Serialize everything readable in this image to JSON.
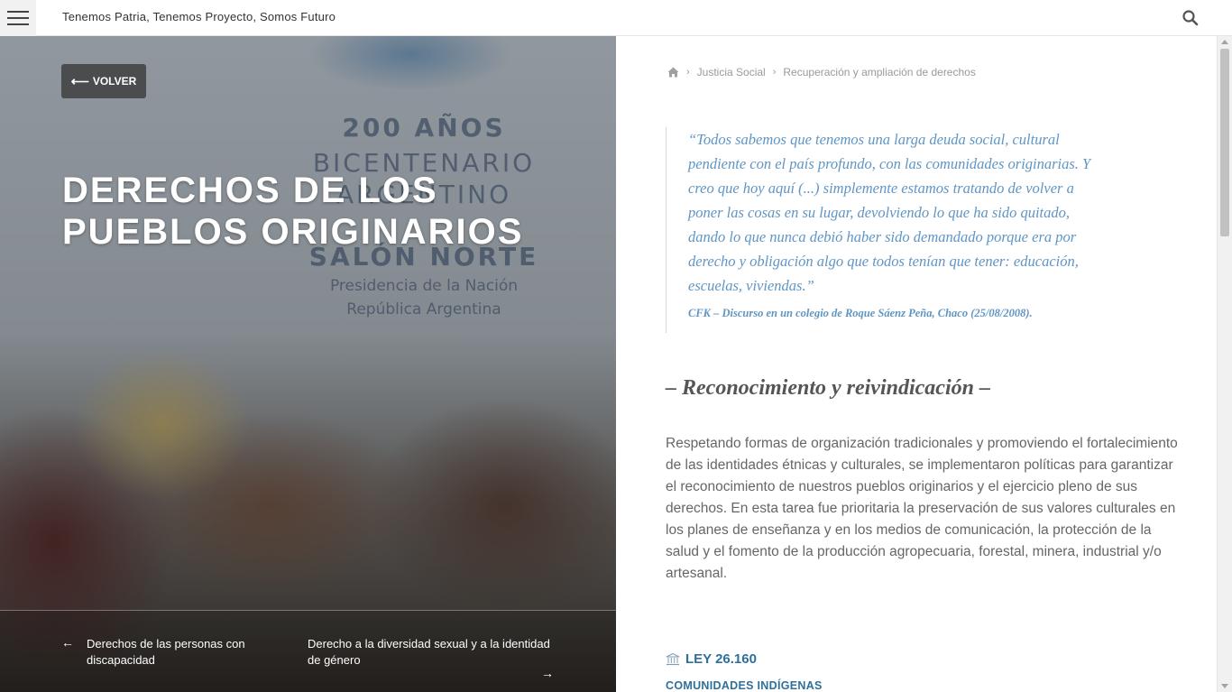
{
  "header": {
    "tagline": "Tenemos Patria, Tenemos Proyecto, Somos Futuro",
    "menu_icon": "hamburger-icon",
    "search_icon": "search-icon"
  },
  "hero": {
    "back_label": "VOLVER",
    "title": "DERECHOS DE LOS PUEBLOS ORIGINARIOS",
    "sign": {
      "l1": "200 AÑOS",
      "l2": "BICENTENARIO",
      "l3": "ARGENTINO",
      "l4": "SALÓN NORTE",
      "l5": "Presidencia de la Nación",
      "l6": "República Argentina"
    },
    "prev": {
      "label": "Derechos de las personas con discapacidad",
      "arrow": "←"
    },
    "next": {
      "label": "Derecho a la diversidad sexual y a la identidad de género",
      "arrow": "→"
    }
  },
  "breadcrumb": {
    "home_icon": "home-icon",
    "items": [
      "Justicia Social",
      "Recuperación y ampliación de derechos"
    ]
  },
  "quote": {
    "text": "“Todos sabemos que tenemos una larga deuda social, cultural pendiente con el país profundo, con las comunidades originarias. Y creo que hoy aquí (...) simplemente estamos tratando de volver a poner las cosas en su lugar, devolviendo lo que ha sido quitado, dando lo que nunca debió haber sido demandado porque era por derecho y obligación algo que todos tenían que tener: educación, escuelas, viviendas.”",
    "source": "CFK – Discurso en un colegio de Roque Sáenz Peña, Chaco (25/08/2008)."
  },
  "section": {
    "title": "– Reconocimiento y reivindicación –",
    "body": "Respetando formas de organización tradicionales y promoviendo el fortalecimiento de las identidades étnicas y culturales, se implementaron políticas para garantizar el reconocimiento de nuestros pueblos originarios y el ejercicio pleno de sus derechos. En esta tarea fue prioritaria la preservación de sus valores culturales en los planes de enseñanza y en los medios de comunicación, la protección de la salud y el fomento de la producción agropecuaria, forestal, minera, industrial y/o artesanal."
  },
  "law": {
    "icon": "institution-icon",
    "title": "LEY 26.160",
    "subtitle": "COMUNIDADES INDÍGENAS"
  },
  "colors": {
    "accent_blue": "#5f95c4",
    "law_blue": "#2f6f9c",
    "text_gray": "#666666"
  }
}
